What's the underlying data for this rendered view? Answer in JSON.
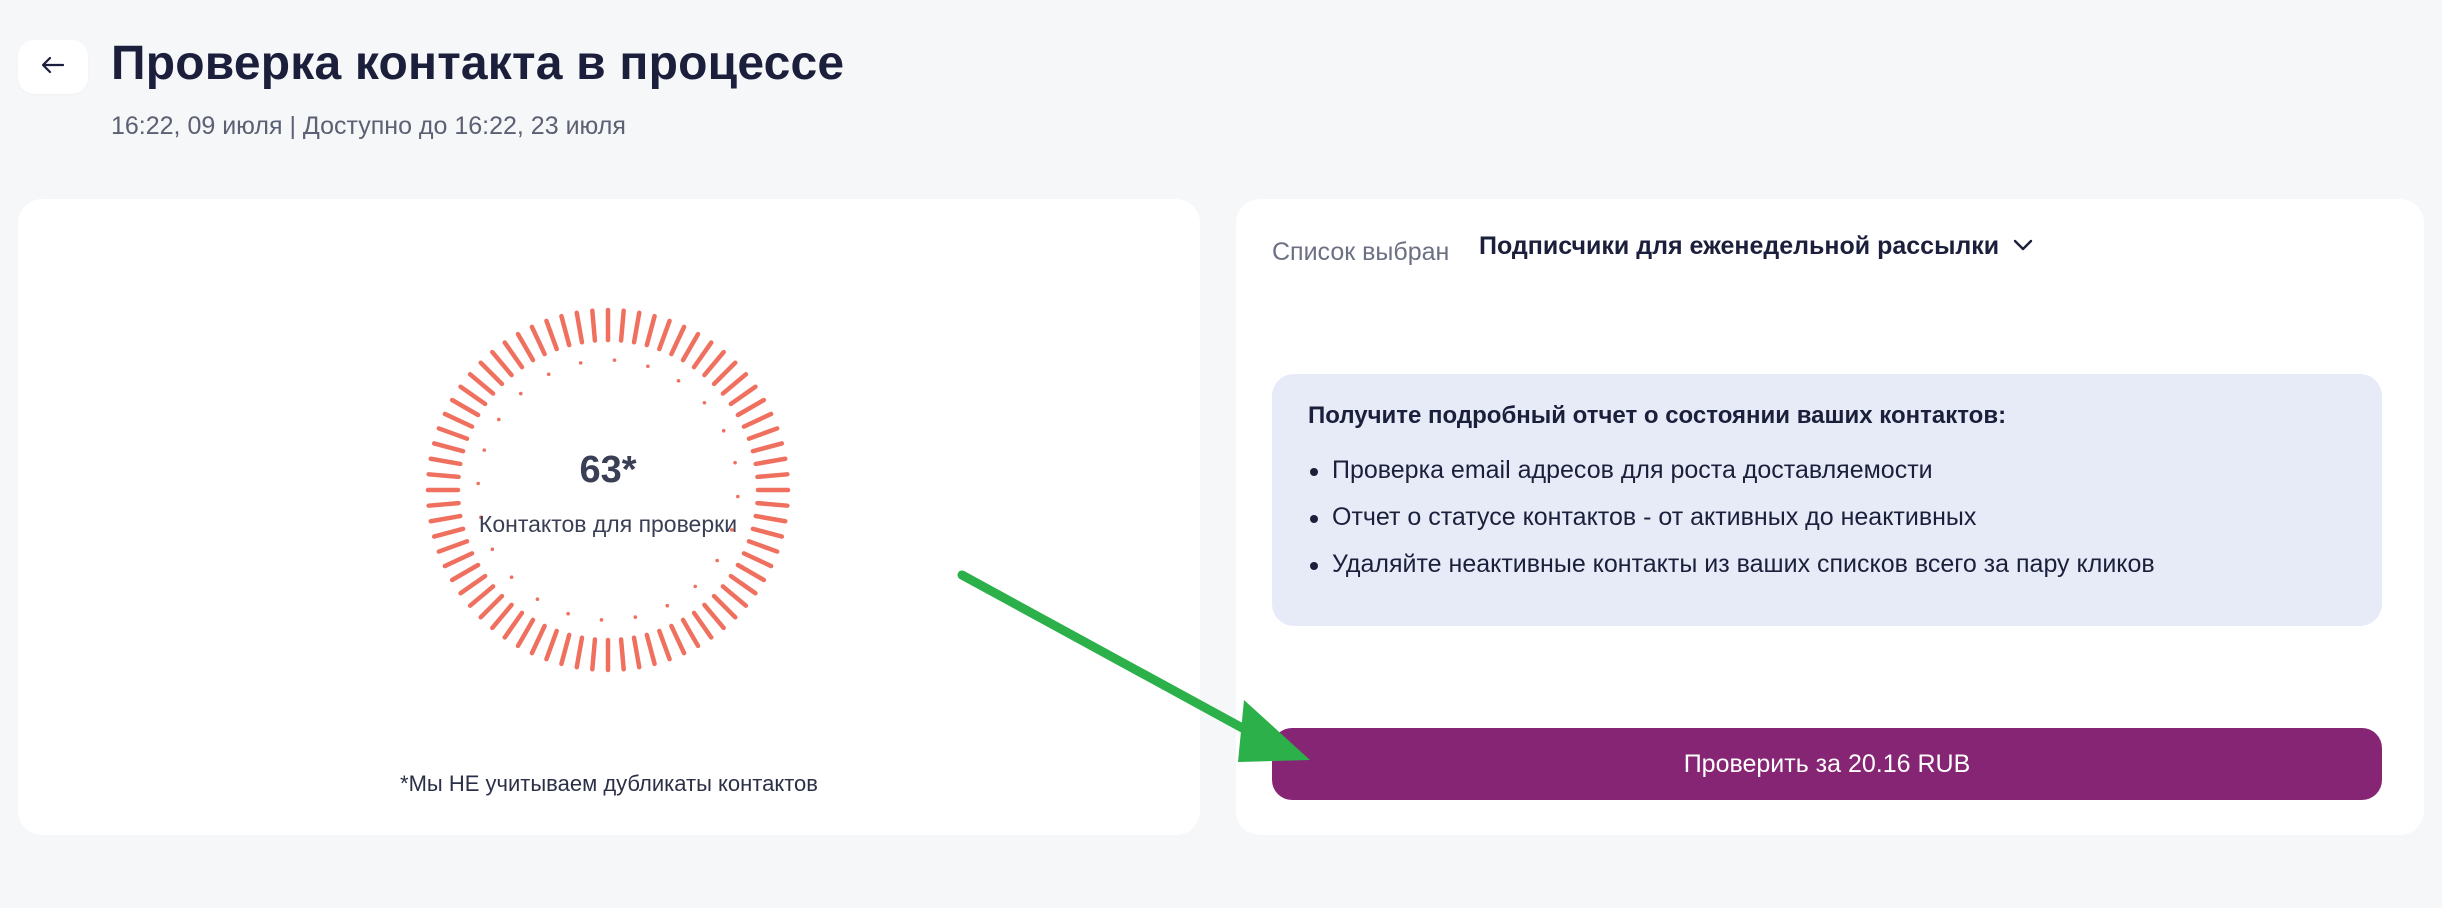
{
  "header": {
    "title": "Проверка контакта в процессе",
    "subtitle": "16:22, 09 июля | Доступно до 16:22, 23 июля"
  },
  "left_card": {
    "count": "63*",
    "count_label": "Контактов для проверки",
    "footnote": "*Мы НЕ учитываем дубликаты контактов",
    "ring_color": "#f07060"
  },
  "right_card": {
    "list_label": "Список выбран",
    "list_value": "Подписчики для еженедельной рассылки",
    "info_title": "Получите подробный отчет о состоянии ваших контактов:",
    "info_items": [
      "Проверка email адресов для роста доставляемости",
      "Отчет о статусе контактов - от активных до неактивных",
      "Удаляйте неактивные контакты из ваших списков всего за пару кликов"
    ],
    "button_label": "Проверить за 20.16 RUB",
    "button_color": "#862573"
  },
  "icons": {
    "back": "arrow-left-icon",
    "dropdown": "chevron-down-icon",
    "annotation": "green-arrow-icon"
  }
}
